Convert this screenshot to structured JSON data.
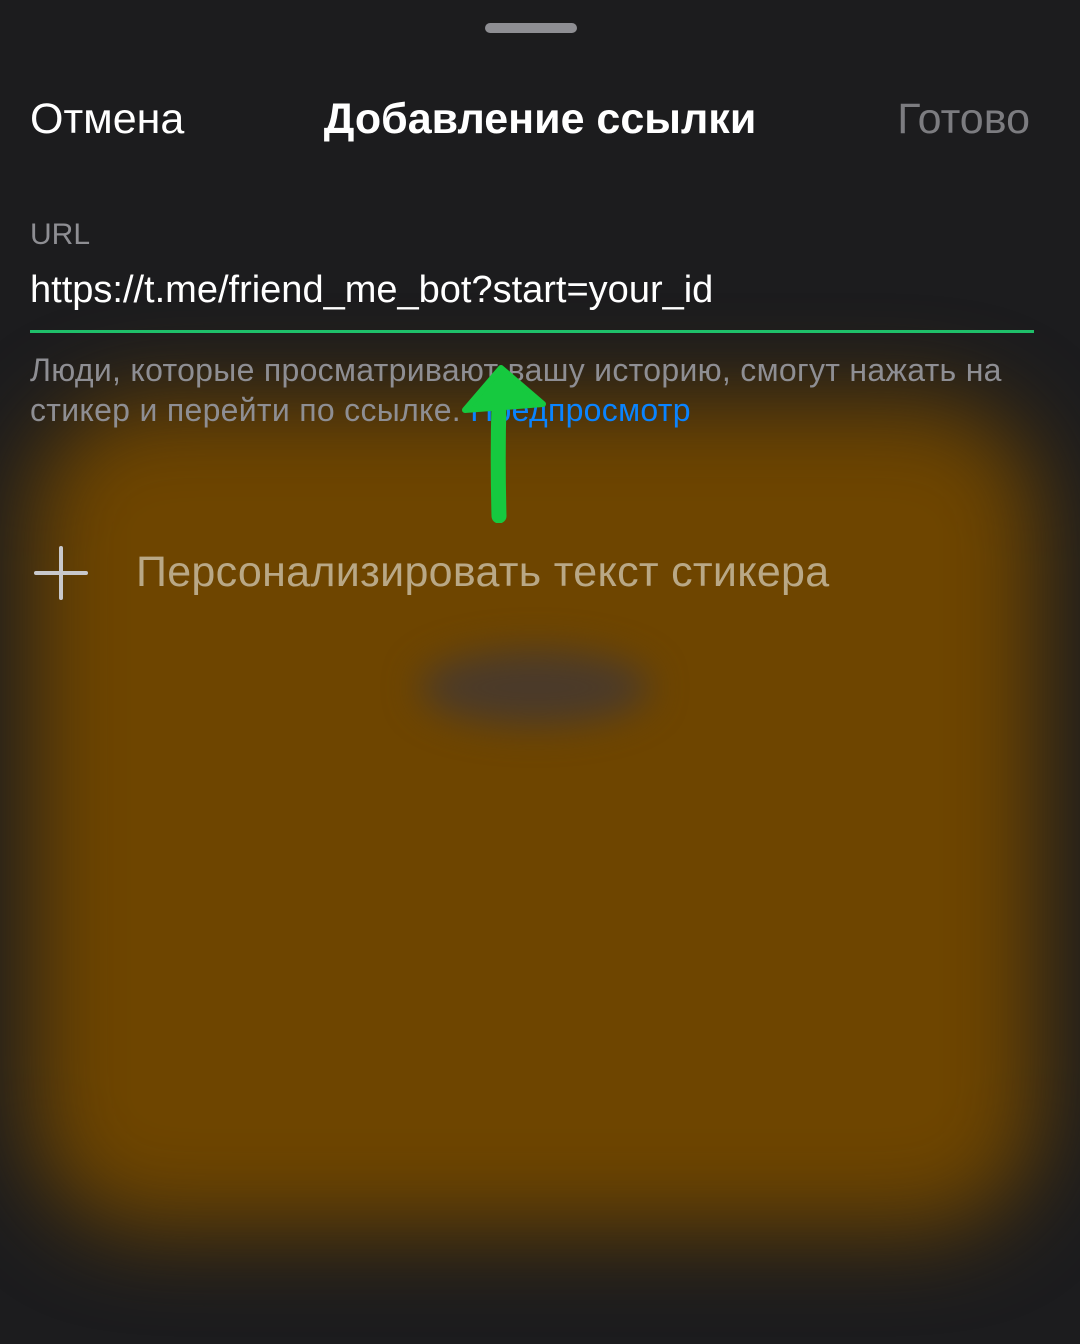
{
  "sheet": {
    "cancel_label": "Отмена",
    "title": "Добавление ссылки",
    "done_label": "Готово"
  },
  "url_field": {
    "label": "URL",
    "value": "https://t.me/friend_me_bot?start=your_id"
  },
  "hint": {
    "text": "Люди, которые просматривают вашу историю, смогут нажать на стикер и перейти по ссылке. ",
    "link_label": "Предпросмотр"
  },
  "customize": {
    "label": "Персонализировать текст стикера"
  },
  "icons": {
    "grabber": "drag-handle",
    "plus": "plus-icon",
    "annotation": "arrow-up-icon"
  },
  "colors": {
    "background": "#1c1c1e",
    "accent_link": "#0a84ff",
    "input_underline": "#1fbf6a",
    "annotation_arrow": "#16c93f",
    "sticker_glow": "#6e4500"
  }
}
